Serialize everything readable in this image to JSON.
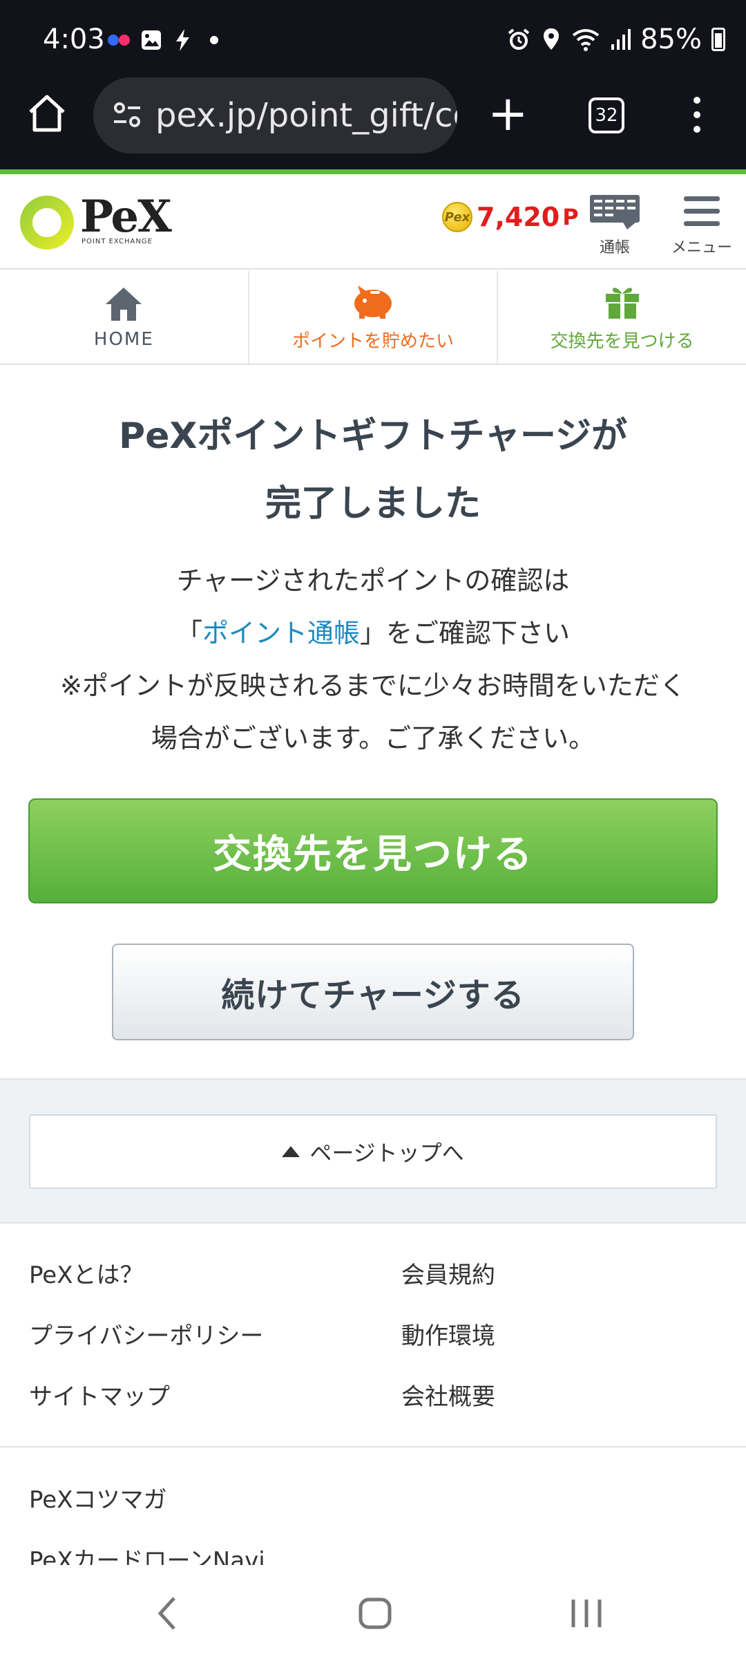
{
  "status_bar": {
    "time": "4:03",
    "battery": "85%",
    "icons": [
      "notification-dots-icon",
      "gallery-icon",
      "bolt-icon",
      "dot-icon",
      "alarm-icon",
      "location-icon",
      "wifi-icon",
      "signal-icon",
      "battery-icon"
    ],
    "dot_colors": [
      "#2f6bff",
      "#ff2d6a"
    ]
  },
  "browser": {
    "url": "pex.jp/point_gift/complete",
    "tab_count": "32"
  },
  "header": {
    "logo_text": "PeX",
    "logo_sub": "POINT EXCHANGE",
    "coin_text": "Pex",
    "points_value": "7,420",
    "points_unit": "P",
    "passbook_label": "通帳",
    "menu_label": "メニュー"
  },
  "nav": {
    "home": "HOME",
    "save": "ポイントを貯めたい",
    "find": "交換先を見つける"
  },
  "main": {
    "heading_line1": "PeXポイントギフトチャージが",
    "heading_line2": "完了しました",
    "desc_line1": "チャージされたポイントの確認は",
    "desc_bracket_open": "「",
    "desc_link": "ポイント通帳",
    "desc_line2_rest": "」をご確認下さい",
    "desc_line3": "※ポイントが反映されるまでに少々お時間をいただく",
    "desc_line4": "場合がございます。ご了承ください。",
    "primary_button": "交換先を見つける",
    "secondary_button": "続けてチャージする"
  },
  "page_top": {
    "label": "ページトップへ"
  },
  "footer": {
    "links": [
      "PeXとは？",
      "会員規約",
      "プライバシーポリシー",
      "動作環境",
      "サイトマップ",
      "会社概要"
    ],
    "links2": [
      "PeXコツマガ",
      "PeXカードローンNavi"
    ]
  },
  "colors": {
    "accent_green": "#5cbd3a",
    "points_red": "#e21d1d",
    "save_orange": "#ef6c1d",
    "link_blue": "#1c8ac0"
  }
}
